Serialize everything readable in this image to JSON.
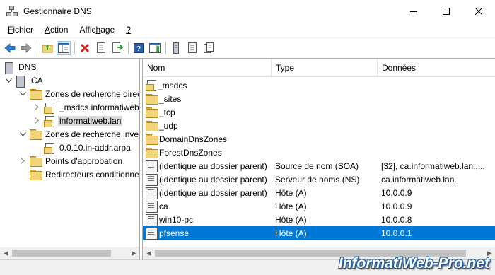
{
  "window": {
    "title": "Gestionnaire DNS",
    "minimize_icon": "minimize-icon",
    "maximize_icon": "maximize-icon",
    "close_icon": "close-icon"
  },
  "menu": {
    "items": [
      {
        "ul": "F",
        "rest": "ichier"
      },
      {
        "ul": "A",
        "rest": "ction"
      },
      {
        "pre": "Affic",
        "ul": "h",
        "rest": "age"
      },
      {
        "ul": "?",
        "rest": ""
      }
    ]
  },
  "toolbar": {
    "buttons": [
      "back-icon",
      "forward-icon",
      "up-folder-icon",
      "show-hide-tree-icon",
      "delete-icon",
      "properties-icon",
      "export-icon",
      "help-icon",
      "action-pane-icon",
      "server-icon",
      "list-icon",
      "copy-icon"
    ]
  },
  "tree": {
    "root": "DNS",
    "server": "CA",
    "forward_zones": "Zones de recherche direc",
    "msdcs": "_msdcs.informatiweb",
    "informatiweb": "informatiweb.lan",
    "reverse_zones": "Zones de recherche inver",
    "reverse_zone": "0.0.10.in-addr.arpa",
    "trust_points": "Points d'approbation",
    "forwarders": "Redirecteurs conditionne"
  },
  "list": {
    "headers": {
      "name": "Nom",
      "type": "Type",
      "data": "Données"
    },
    "rows": [
      {
        "name": "_msdcs",
        "type": "",
        "data": "",
        "icon": "zone-folder-icon"
      },
      {
        "name": "_sites",
        "type": "",
        "data": "",
        "icon": "folder-icon"
      },
      {
        "name": "_tcp",
        "type": "",
        "data": "",
        "icon": "folder-icon"
      },
      {
        "name": "_udp",
        "type": "",
        "data": "",
        "icon": "folder-icon"
      },
      {
        "name": "DomainDnsZones",
        "type": "",
        "data": "",
        "icon": "folder-icon"
      },
      {
        "name": "ForestDnsZones",
        "type": "",
        "data": "",
        "icon": "folder-icon"
      },
      {
        "name": "(identique au dossier parent)",
        "type": "Source de nom (SOA)",
        "data": "[32], ca.informatiweb.lan.,...",
        "icon": "record-icon"
      },
      {
        "name": "(identique au dossier parent)",
        "type": "Serveur de noms (NS)",
        "data": "ca.informatiweb.lan.",
        "icon": "record-icon"
      },
      {
        "name": "(identique au dossier parent)",
        "type": "Hôte (A)",
        "data": "10.0.0.9",
        "icon": "record-icon"
      },
      {
        "name": "ca",
        "type": "Hôte (A)",
        "data": "10.0.0.9",
        "icon": "record-icon"
      },
      {
        "name": "win10-pc",
        "type": "Hôte (A)",
        "data": "10.0.0.8",
        "icon": "record-icon"
      },
      {
        "name": "pfsense",
        "type": "Hôte (A)",
        "data": "10.0.0.1",
        "icon": "record-icon",
        "selected": true
      }
    ]
  },
  "watermark": "InformatiWeb-Pro.net",
  "colors": {
    "selection": "#0078d7",
    "folder": "#f2d47a",
    "accent_blue": "#1f5fa0"
  }
}
